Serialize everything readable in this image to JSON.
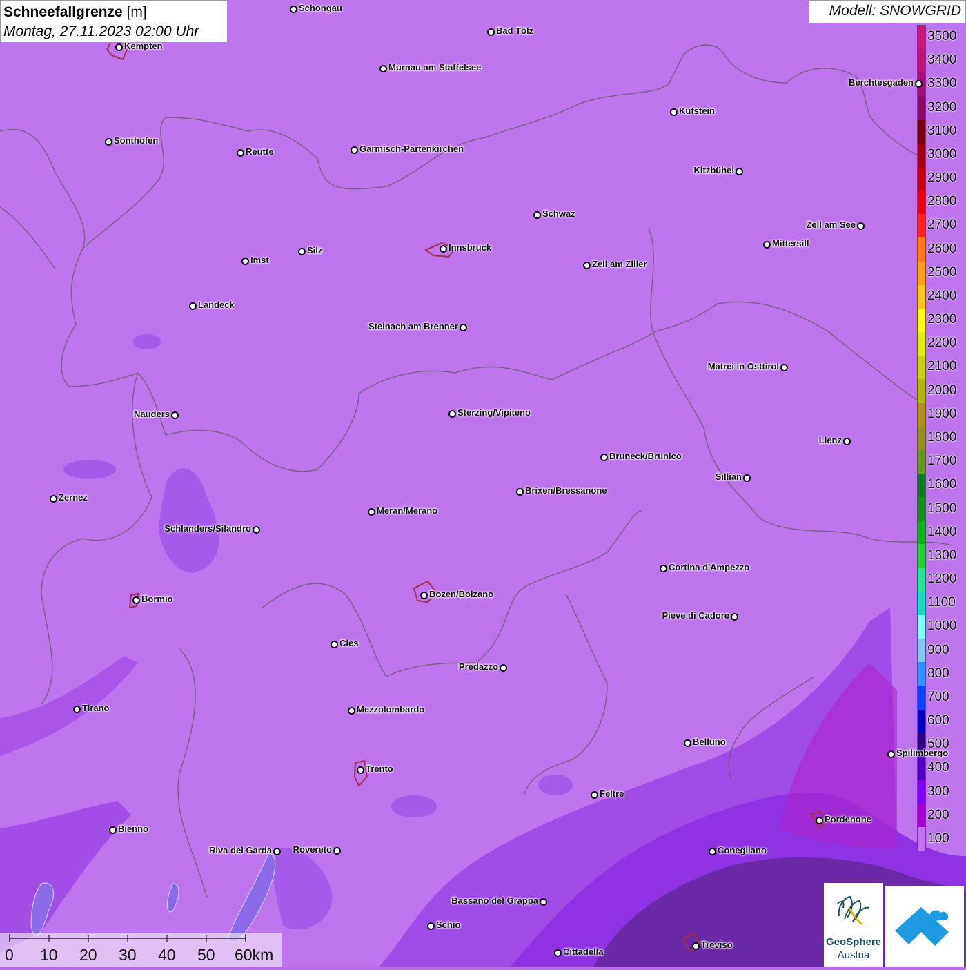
{
  "title": {
    "parameter": "Schneefallgrenze",
    "unit": "[m]",
    "datetime": "Montag, 27.11.2023 02:00 Uhr"
  },
  "model": "Modell: SNOWGRID",
  "legend": [
    {
      "label": "3500",
      "color": "#c8177a"
    },
    {
      "label": "3400",
      "color": "#b8157a"
    },
    {
      "label": "3300",
      "color": "#a0107a"
    },
    {
      "label": "3200",
      "color": "#8a0a6a"
    },
    {
      "label": "3100",
      "color": "#7a0010"
    },
    {
      "label": "3000",
      "color": "#a00010"
    },
    {
      "label": "2900",
      "color": "#c40010"
    },
    {
      "label": "2800",
      "color": "#e60010"
    },
    {
      "label": "2700",
      "color": "#ff2020"
    },
    {
      "label": "2600",
      "color": "#ff7a10"
    },
    {
      "label": "2500",
      "color": "#ffa010"
    },
    {
      "label": "2400",
      "color": "#ffc810"
    },
    {
      "label": "2300",
      "color": "#ffff00"
    },
    {
      "label": "2200",
      "color": "#ddf000"
    },
    {
      "label": "2100",
      "color": "#c6d800"
    },
    {
      "label": "2000",
      "color": "#b0b800"
    },
    {
      "label": "1900",
      "color": "#b09010"
    },
    {
      "label": "1800",
      "color": "#90901a"
    },
    {
      "label": "1700",
      "color": "#609818"
    },
    {
      "label": "1600",
      "color": "#107820"
    },
    {
      "label": "1500",
      "color": "#10901a"
    },
    {
      "label": "1400",
      "color": "#10b018"
    },
    {
      "label": "1300",
      "color": "#20d030"
    },
    {
      "label": "1200",
      "color": "#20e890"
    },
    {
      "label": "1100",
      "color": "#10e0c0"
    },
    {
      "label": "1000",
      "color": "#80ffff"
    },
    {
      "label": "900",
      "color": "#80c8f0"
    },
    {
      "label": "800",
      "color": "#3090ff"
    },
    {
      "label": "700",
      "color": "#0a40ff"
    },
    {
      "label": "600",
      "color": "#0000c0"
    },
    {
      "label": "500",
      "color": "#300080"
    },
    {
      "label": "400",
      "color": "#5000c0"
    },
    {
      "label": "300",
      "color": "#8000f0"
    },
    {
      "label": "200",
      "color": "#a000d0"
    },
    {
      "label": "100",
      "color": "#c070f0"
    }
  ],
  "cities": [
    {
      "name": "Schongau",
      "side": "right"
    },
    {
      "name": "Bad Tölz",
      "side": "right"
    },
    {
      "name": "Kempten",
      "side": "right"
    },
    {
      "name": "Murnau am Staffelsee",
      "side": "right"
    },
    {
      "name": "Berchtesgaden",
      "side": "left"
    },
    {
      "name": "Kufstein",
      "side": "right"
    },
    {
      "name": "Sonthofen",
      "side": "right"
    },
    {
      "name": "Reutte",
      "side": "right"
    },
    {
      "name": "Garmisch-Partenkirchen",
      "side": "right"
    },
    {
      "name": "Kitzbühel",
      "side": "left"
    },
    {
      "name": "Schwaz",
      "side": "right"
    },
    {
      "name": "Zell am See",
      "side": "left"
    },
    {
      "name": "Mittersill",
      "side": "right"
    },
    {
      "name": "Innsbruck",
      "side": "right"
    },
    {
      "name": "Imst",
      "side": "right"
    },
    {
      "name": "Silz",
      "side": "right"
    },
    {
      "name": "Zell am Ziller",
      "side": "right"
    },
    {
      "name": "Landeck",
      "side": "right"
    },
    {
      "name": "Steinach am Brenner",
      "side": "left"
    },
    {
      "name": "Matrei in Osttirol",
      "side": "left"
    },
    {
      "name": "Nauders",
      "side": "left"
    },
    {
      "name": "Sterzing/Vipiteno",
      "side": "right"
    },
    {
      "name": "Lienz",
      "side": "left"
    },
    {
      "name": "Bruneck/Brunico",
      "side": "right"
    },
    {
      "name": "Sillian",
      "side": "left"
    },
    {
      "name": "Zernez",
      "side": "right"
    },
    {
      "name": "Brixen/Bressanone",
      "side": "right"
    },
    {
      "name": "Meran/Merano",
      "side": "right"
    },
    {
      "name": "Schlanders/Silandro",
      "side": "left"
    },
    {
      "name": "Cortina d'Ampezzo",
      "side": "right"
    },
    {
      "name": "Bozen/Bolzano",
      "side": "right"
    },
    {
      "name": "Bormio",
      "side": "right"
    },
    {
      "name": "Pieve di Cadore",
      "side": "left"
    },
    {
      "name": "Cles",
      "side": "right"
    },
    {
      "name": "Predazzo",
      "side": "left"
    },
    {
      "name": "Tirano",
      "side": "right"
    },
    {
      "name": "Mezzolombardo",
      "side": "right"
    },
    {
      "name": "Belluno",
      "side": "right"
    },
    {
      "name": "Spilimbergo",
      "side": "right"
    },
    {
      "name": "Trento",
      "side": "right"
    },
    {
      "name": "Feltre",
      "side": "right"
    },
    {
      "name": "Pordenone",
      "side": "right"
    },
    {
      "name": "Bienno",
      "side": "right"
    },
    {
      "name": "Riva del Garda",
      "side": "left"
    },
    {
      "name": "Rovereto",
      "side": "left"
    },
    {
      "name": "Conegliano",
      "side": "right"
    },
    {
      "name": "Bassano del Grappa",
      "side": "left"
    },
    {
      "name": "Schio",
      "side": "right"
    },
    {
      "name": "Treviso",
      "side": "right"
    },
    {
      "name": "Cittadella",
      "side": "right"
    }
  ],
  "scalebar": {
    "labels": [
      "0",
      "10",
      "20",
      "30",
      "40",
      "50",
      "60km"
    ]
  },
  "logos": {
    "geosphere_line1": "GeoSphere",
    "geosphere_line2": "Austria"
  }
}
